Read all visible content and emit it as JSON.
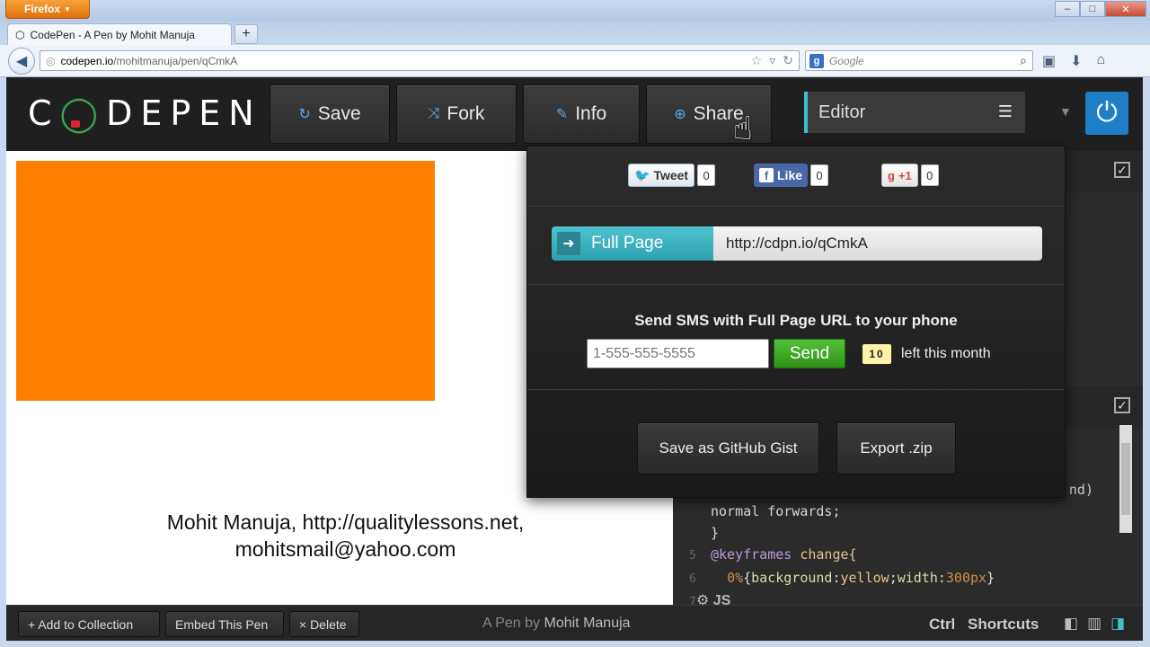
{
  "browser": {
    "menu_label": "Firefox",
    "tab_title": "CodePen - A Pen by Mohit Manuja",
    "new_tab": "+",
    "url_host": "codepen.io",
    "url_path": "/mohitmanuja/pen/qCmkA",
    "search_placeholder": "Google",
    "window_controls": [
      "–",
      "□",
      "✕"
    ]
  },
  "header": {
    "logo": "C  DEPEN",
    "buttons": {
      "save": "Save",
      "fork": "Fork",
      "info": "Info",
      "share": "Share"
    },
    "editor_select": "Editor"
  },
  "share_popover": {
    "tweet_label": "Tweet",
    "tweet_count": "0",
    "like_label": "Like",
    "like_count": "0",
    "gplus_label": "+1",
    "gplus_count": "0",
    "full_page_label": "Full Page",
    "full_page_url": "http://cdpn.io/qCmkA",
    "sms_title": "Send SMS with Full Page URL to your phone",
    "sms_placeholder": "1-555-555-5555",
    "sms_send": "Send",
    "sms_remaining": "10",
    "sms_remaining_text": "left this month",
    "gist_button": "Save as GitHub Gist",
    "zip_button": "Export .zip"
  },
  "preview": {
    "box_color": "#ff7f00",
    "credit_line1": "Mohit Manuja, http://qualitylessons.net,",
    "credit_line2": "mohitsmail@yahoo.com"
  },
  "code": {
    "line_a": "normal forwards;",
    "line_b": "}",
    "ln5": "5",
    "ln6": "6",
    "ln7": "7",
    "keyframes_kw": "@keyframes",
    "keyframes_name": "change{",
    "frame_sel": "0%",
    "frame_body_open": "{",
    "prop1": "background",
    "val1": "yellow",
    "prop2": "width",
    "val2": "300px",
    "frame_body_close": "}",
    "partial": "nd)",
    "js_label": "JS"
  },
  "footer": {
    "add_collection": "+ Add to Collection",
    "embed": "Embed This Pen",
    "delete": "× Delete",
    "pen_by": "A Pen by ",
    "author": "Mohit Manuja",
    "ctrl": "Ctrl",
    "shortcuts": "Shortcuts"
  },
  "colors": {
    "accent_teal": "#3ec0d0",
    "power_blue": "#1f7fc6",
    "send_green": "#2f9218"
  }
}
